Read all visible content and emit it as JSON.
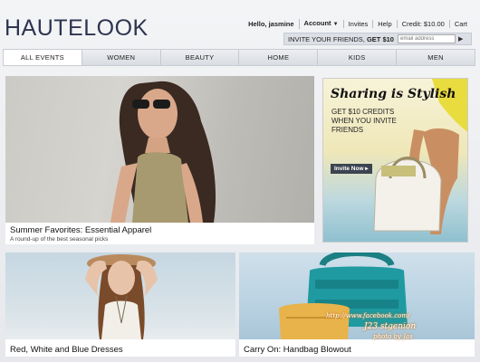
{
  "header": {
    "logo": "HAUTELOOK",
    "topnav": {
      "greeting": "Hello, jasmine",
      "account": "Account",
      "invites": "Invites",
      "help": "Help",
      "credit": "Credit: $10.00",
      "cart": "Cart"
    },
    "invite_bar": {
      "text_prefix": "INVITE YOUR FRIENDS, ",
      "text_bold": "GET $10",
      "email_placeholder": "email address"
    }
  },
  "nav": {
    "tabs": [
      "ALL EVENTS",
      "WOMEN",
      "BEAUTY",
      "HOME",
      "KIDS",
      "MEN"
    ]
  },
  "tiles": {
    "summer": {
      "title": "Summer Favorites: Essential Apparel",
      "subtitle": "A round-up of the best seasonal picks"
    },
    "sharing": {
      "title": "Sharing is Stylish",
      "body": "GET $10 CREDITS WHEN YOU INVITE FRIENDS",
      "button": "Invite Now ▸"
    },
    "dresses": {
      "title": "Red, White and Blue Dresses"
    },
    "handbag": {
      "title": "Carry On: Handbag Blowout"
    }
  },
  "watermark": {
    "line1": "http://www.facebook.com/",
    "line2": "J23 stgenion",
    "line3": "photo by Jas"
  },
  "colors": {
    "logo": "#2d3550",
    "active_tab": "#ffffff",
    "invite_button": "#3c4450"
  }
}
